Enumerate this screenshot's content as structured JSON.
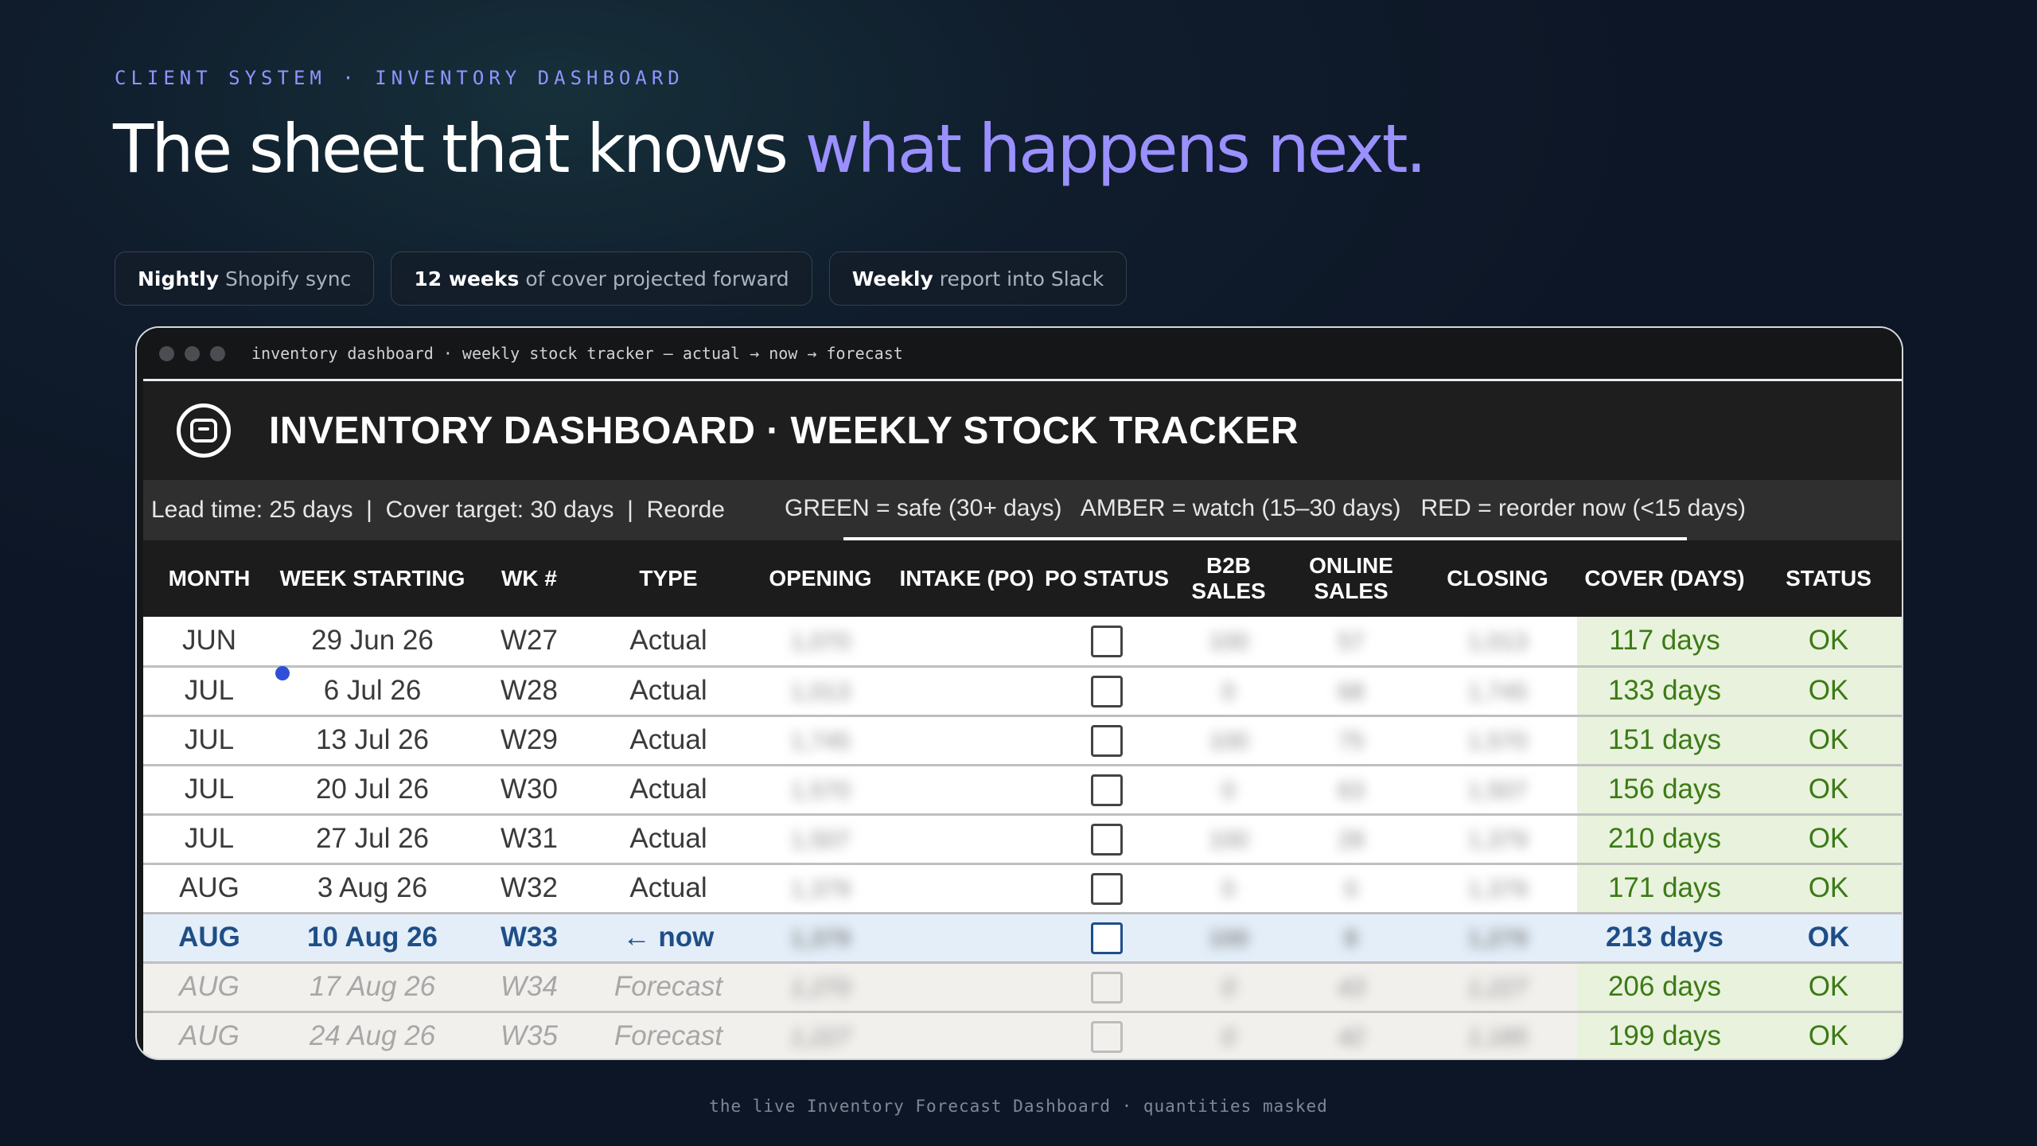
{
  "eyebrow": "CLIENT SYSTEM · INVENTORY DASHBOARD",
  "headline": {
    "lead": "The sheet that knows ",
    "accent": "what happens next."
  },
  "pills": [
    {
      "strong": "Nightly",
      "rest": "Shopify sync"
    },
    {
      "strong": "12 weeks",
      "rest": "of cover projected forward"
    },
    {
      "strong": "Weekly",
      "rest": "report into Slack"
    }
  ],
  "window": {
    "title": "inventory dashboard · weekly stock tracker — actual → now → forecast",
    "sheet_title": "INVENTORY DASHBOARD · WEEKLY STOCK TRACKER",
    "info_left": "Lead time: 25 days  |  Cover target: 30 days  |  Reorde",
    "info_right": "GREEN = safe (30+ days)   AMBER = watch (15–30 days)   RED = reorder now (<15 days)"
  },
  "table": {
    "headers": [
      "MONTH",
      "WEEK STARTING",
      "WK #",
      "TYPE",
      "OPENING",
      "INTAKE (PO)",
      "PO STATUS",
      "B2B SALES",
      "ONLINE SALES",
      "CLOSING",
      "COVER (DAYS)",
      "STATUS"
    ],
    "rows": [
      {
        "month": "JUN",
        "week": "29 Jun 26",
        "wk": "W27",
        "type": "Actual",
        "opening": "1,070",
        "intake": "",
        "b2b": "100",
        "online": "57",
        "closing": "1,013",
        "cover": "117 days",
        "status": "OK",
        "kind": "actual"
      },
      {
        "month": "JUL",
        "week": "6 Jul 26",
        "wk": "W28",
        "type": "Actual",
        "opening": "1,013",
        "intake": "",
        "b2b": "0",
        "online": "68",
        "closing": "1,745",
        "cover": "133 days",
        "status": "OK",
        "kind": "actual"
      },
      {
        "month": "JUL",
        "week": "13 Jul 26",
        "wk": "W29",
        "type": "Actual",
        "opening": "1,745",
        "intake": "",
        "b2b": "100",
        "online": "75",
        "closing": "1,570",
        "cover": "151 days",
        "status": "OK",
        "kind": "actual"
      },
      {
        "month": "JUL",
        "week": "20 Jul 26",
        "wk": "W30",
        "type": "Actual",
        "opening": "1,570",
        "intake": "",
        "b2b": "0",
        "online": "63",
        "closing": "1,507",
        "cover": "156 days",
        "status": "OK",
        "kind": "actual"
      },
      {
        "month": "JUL",
        "week": "27 Jul 26",
        "wk": "W31",
        "type": "Actual",
        "opening": "1,507",
        "intake": "",
        "b2b": "100",
        "online": "28",
        "closing": "1,379",
        "cover": "210 days",
        "status": "OK",
        "kind": "actual"
      },
      {
        "month": "AUG",
        "week": "3 Aug 26",
        "wk": "W32",
        "type": "Actual",
        "opening": "1,379",
        "intake": "",
        "b2b": "0",
        "online": "0",
        "closing": "1,379",
        "cover": "171 days",
        "status": "OK",
        "kind": "actual"
      },
      {
        "month": "AUG",
        "week": "10 Aug 26",
        "wk": "W33",
        "type": "← now",
        "opening": "1,379",
        "intake": "",
        "b2b": "100",
        "online": "8",
        "closing": "1,279",
        "cover": "213 days",
        "status": "OK",
        "kind": "now"
      },
      {
        "month": "AUG",
        "week": "17 Aug 26",
        "wk": "W34",
        "type": "Forecast",
        "opening": "1,270",
        "intake": "",
        "b2b": "0",
        "online": "43",
        "closing": "1,227",
        "cover": "206 days",
        "status": "OK",
        "kind": "forecast"
      },
      {
        "month": "AUG",
        "week": "24 Aug 26",
        "wk": "W35",
        "type": "Forecast",
        "opening": "1,227",
        "intake": "",
        "b2b": "0",
        "online": "42",
        "closing": "1,185",
        "cover": "199 days",
        "status": "OK",
        "kind": "forecast"
      }
    ]
  },
  "caption": "the live Inventory Forecast Dashboard · quantities masked"
}
